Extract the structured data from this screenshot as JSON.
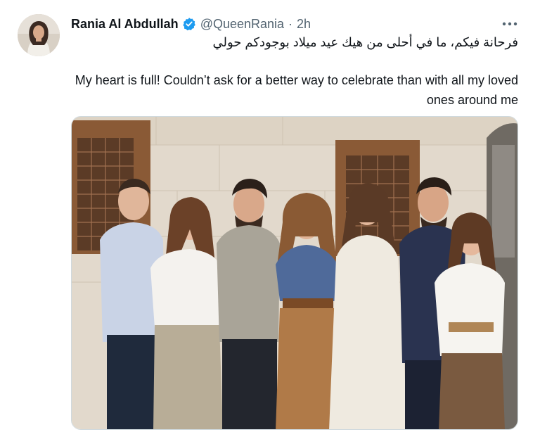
{
  "tweet": {
    "author_name": "Rania Al Abdullah",
    "handle": "@QueenRania",
    "separator": "·",
    "time": "2h",
    "verified": true,
    "text_arabic": "فرحانة فيكم، ما في أحلى من هيك عيد ميلاد بوجودكم حولي",
    "text_english": "My heart is full! Couldn’t ask for a better way to celebrate than with all my loved ones around me",
    "icons": {
      "verified": "verified-badge-icon",
      "more": "more-options-icon"
    },
    "colors": {
      "verified": "#1d9bf0",
      "text": "#0f1419",
      "secondary": "#536471"
    }
  }
}
